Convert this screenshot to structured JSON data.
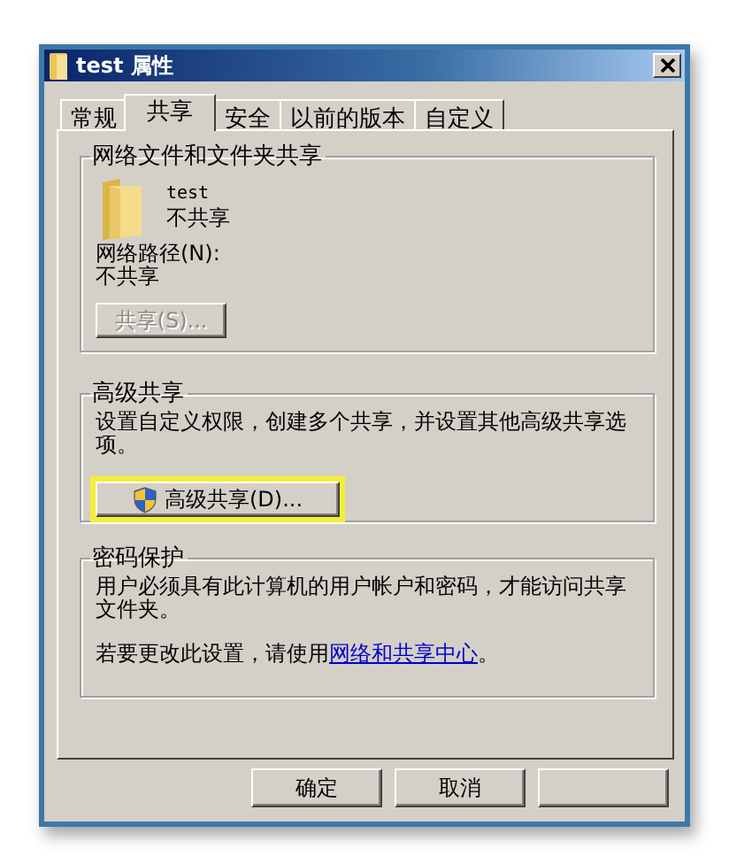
{
  "window": {
    "title": "test 属性"
  },
  "tabs": [
    {
      "label": "常规",
      "selected": false
    },
    {
      "label": "共享",
      "selected": true
    },
    {
      "label": "安全",
      "selected": false
    },
    {
      "label": "以前的版本",
      "selected": false
    },
    {
      "label": "自定义",
      "selected": false
    }
  ],
  "sharing": {
    "title": "网络文件和文件夹共享",
    "folder_name": "test",
    "status": "不共享",
    "path_label": "网络路径(N):",
    "path_value": "不共享",
    "button": {
      "label": "共享(S)...",
      "disabled": true
    }
  },
  "advanced": {
    "title": "高级共享",
    "description": "设置自定义权限，创建多个共享，并设置其他高级共享选项。",
    "button": {
      "label": "高级共享(D)...",
      "highlighted": true
    }
  },
  "password": {
    "title": "密码保护",
    "description": "用户必须具有此计算机的用户帐户和密码，才能访问共享文件夹。",
    "note_before": "若要更改此设置，请使用",
    "link": "网络和共享中心",
    "note_after": "。"
  },
  "buttons": [
    {
      "kind": "labeled",
      "label": "确定"
    },
    {
      "kind": "labeled",
      "label": "取消"
    },
    {
      "kind": "covered"
    }
  ]
}
